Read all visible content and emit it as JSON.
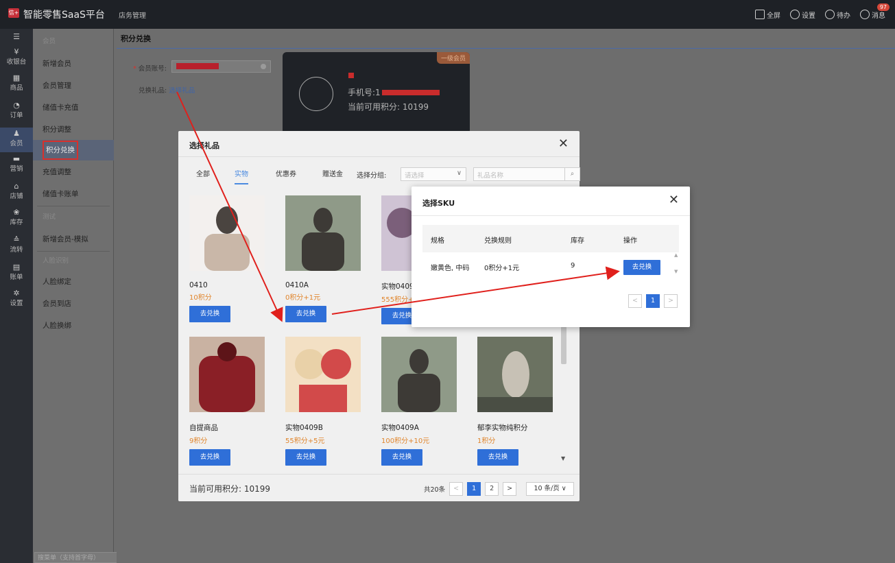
{
  "topbar": {
    "logo": "信+",
    "title": "智能零售SaaS平台",
    "subnav": "店务管理",
    "tools": {
      "fullscreen": "全屏",
      "settings": "设置",
      "todo": "待办",
      "messages": "消息",
      "badge": "97"
    }
  },
  "rail": {
    "menu": "☰",
    "items": [
      {
        "glyph": "¥",
        "label": "收银台"
      },
      {
        "glyph": "▦",
        "label": "商品"
      },
      {
        "glyph": "◔",
        "label": "订单"
      },
      {
        "glyph": "♟",
        "label": "会员"
      },
      {
        "glyph": "▬",
        "label": "营销"
      },
      {
        "glyph": "⌂",
        "label": "店铺"
      },
      {
        "glyph": "❀",
        "label": "库存"
      },
      {
        "glyph": "≙",
        "label": "流转"
      },
      {
        "glyph": "▤",
        "label": "账单"
      },
      {
        "glyph": "✲",
        "label": "设置"
      }
    ]
  },
  "submenu": {
    "group_member": "会员",
    "items1": [
      "新增会员",
      "会员管理",
      "储值卡充值",
      "积分调整",
      "积分兑换",
      "充值调整",
      "储值卡账单"
    ],
    "group_test": "测试",
    "items2": [
      "新增会员-模拟"
    ],
    "group_face": "人脸识别",
    "items3": [
      "人脸绑定",
      "会员到店",
      "人脸换绑"
    ],
    "search_placeholder": "搜菜单（支持首字母）"
  },
  "page": {
    "title": "积分兑换",
    "account_label": "会员账号:",
    "gift_label": "兑换礼品:",
    "gift_link": "选择礼品"
  },
  "member_card": {
    "level": "一级会员",
    "phone_label": "手机号:1",
    "points_text": "当前可用积分: 10199"
  },
  "gift_dialog": {
    "title": "选择礼品",
    "close": "✕",
    "tabs": [
      "全部",
      "实物",
      "优惠券",
      "赠送金"
    ],
    "group_label": "选择分组:",
    "group_placeholder": "请选择",
    "search_placeholder": "礼品名称",
    "redeem_label": "去兑换",
    "gifts": [
      {
        "name": "0410",
        "price": "10积分",
        "colors": [
          "#f3f0ee",
          "#4a4440",
          "#c9b7a8"
        ]
      },
      {
        "name": "0410A",
        "price": "0积分+1元",
        "colors": [
          "#8f9a88",
          "#3d3a36",
          "#e9e6e0"
        ]
      },
      {
        "name": "实物0409",
        "price": "555积分+",
        "colors": [
          "#cfc3d4",
          "#7b5f7a",
          "#e8e2de"
        ]
      },
      {
        "name": "自提商品",
        "price": "9积分",
        "colors": [
          "#c9b2a2",
          "#8a1f26",
          "#5d1418"
        ]
      },
      {
        "name": "实物0409B",
        "price": "55积分+5元",
        "colors": [
          "#f3e0c4",
          "#d24a4a",
          "#e9d1a8"
        ]
      },
      {
        "name": "实物0409A",
        "price": "100积分+10元",
        "colors": [
          "#8f9a88",
          "#3d3a36",
          "#e9e6e0"
        ]
      },
      {
        "name": "郁李实物纯积分",
        "price": "1积分",
        "colors": [
          "#6b7261",
          "#c7c1b5",
          "#4a4e44"
        ]
      }
    ],
    "footer_points": "当前可用积分: 10199",
    "total": "共20条",
    "pages": [
      "1",
      "2"
    ],
    "page_size": "10 条/页 ∨"
  },
  "sku_dialog": {
    "title": "选择SKU",
    "close": "✕",
    "headers": [
      "规格",
      "兑换规则",
      "库存",
      "操作"
    ],
    "row": {
      "spec": "嫩黄色, 中码",
      "rule": "0积分+1元",
      "stock": "9",
      "action": "去兑换"
    },
    "page": "1"
  }
}
